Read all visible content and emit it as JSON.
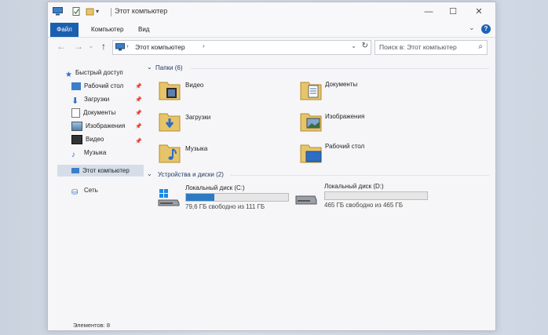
{
  "window": {
    "title": "Этот компьютер"
  },
  "ribbon": {
    "tabs": [
      "Файл",
      "Компьютер",
      "Вид"
    ]
  },
  "address": {
    "path": "Этот компьютер"
  },
  "search": {
    "placeholder": "Поиск в: Этот компьютер"
  },
  "sidebar": {
    "quick_access": "Быстрый доступ",
    "items": [
      "Рабочий стол",
      "Загрузки",
      "Документы",
      "Изображения",
      "Видео",
      "Музыка"
    ],
    "this_pc": "Этот компьютер",
    "network": "Сеть"
  },
  "folders_header": "Папки (6)",
  "folders": [
    "Видео",
    "Документы",
    "Загрузки",
    "Изображения",
    "Музыка",
    "Рабочий стол"
  ],
  "devices_header": "Устройства и диски (2)",
  "drives": [
    {
      "name": "Локальный диск (C:)",
      "free": "79,6 ГБ свободно из 111 ГБ",
      "used_fraction": 0.28
    },
    {
      "name": "Локальный диск (D:)",
      "free": "465 ГБ свободно из 465 ГБ",
      "used_fraction": 0.0
    }
  ],
  "status": {
    "items": "Элементов: 8"
  },
  "colors": {
    "accent": "#1b5fb0",
    "drive_fill": "#2d7ac2",
    "folder": "#e7c46a"
  }
}
